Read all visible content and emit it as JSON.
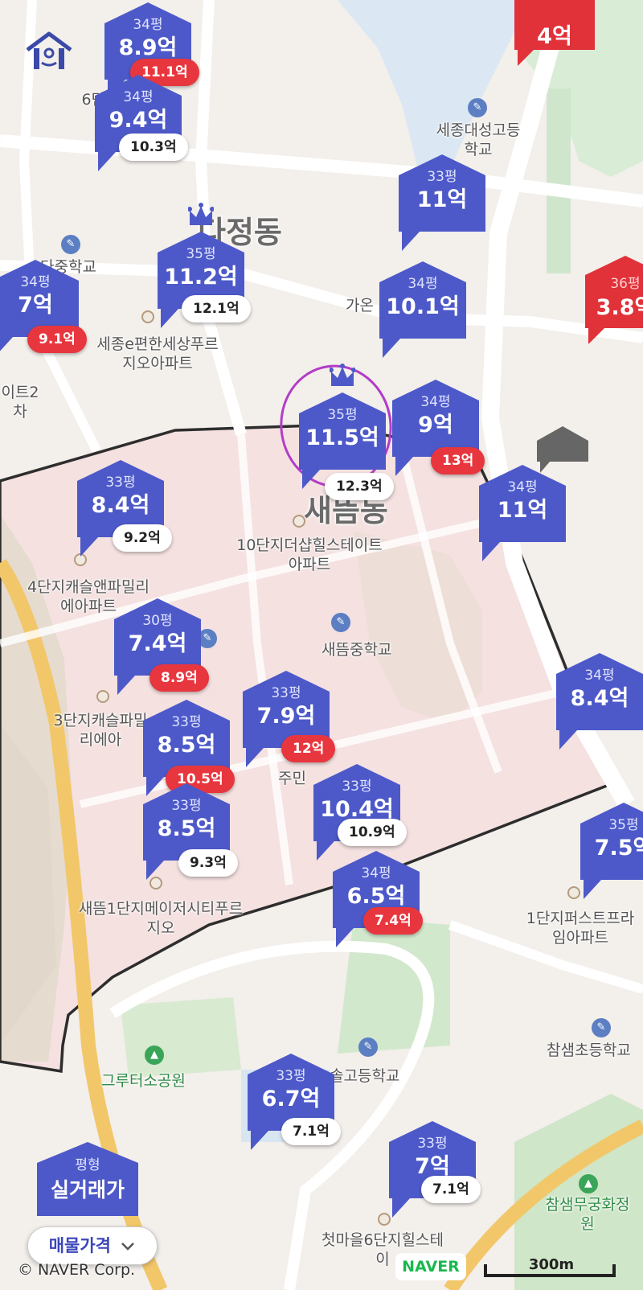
{
  "colors": {
    "marker_blue": "#4d59c8",
    "marker_red": "#e13139",
    "pill_red": "#e8363e",
    "crown": "#4d59c8",
    "highlight_circle": "#b23cc7"
  },
  "dong_labels": {
    "top": "다정동",
    "center": "새뜸동"
  },
  "place_labels": [
    "6단지캐스센트",
    "세종대성고등학교",
    "다중학교",
    "세종e편한세상푸르지오아파트",
    "가온",
    "이트2차",
    "10단지더샵힐스테이트아파트",
    "4단지캐슬앤파밀리에아파트",
    "새뜸중학교",
    "3단지캐슬파밀리에아",
    "주민",
    "새뜸1단지메이저시티푸르지오",
    "1단지퍼스트프라임아파트",
    "참샘초등학교",
    "그루터소공원",
    "솔고등학교",
    "참샘무궁화정원",
    "첫마을6단지힐스테이"
  ],
  "poi_icons": [
    "school-icon",
    "park-icon",
    "apartment-icon"
  ],
  "markers": [
    {
      "area": "34평",
      "price": "8.9억",
      "pill": "11.1억",
      "pill_color": "red"
    },
    {
      "area": "34평",
      "price": "9.4억",
      "pill": "10.3억",
      "pill_color": "white"
    },
    {
      "area": "33평",
      "price": "11억",
      "pill": "",
      "pill_color": ""
    },
    {
      "area": "35평",
      "price": "11.2억",
      "pill": "12.1억",
      "pill_color": "white",
      "crown": true
    },
    {
      "area": "34평",
      "price": "7억",
      "pill": "9.1억",
      "pill_color": "red"
    },
    {
      "area": "34평",
      "price": "10.1억",
      "pill": "",
      "pill_color": ""
    },
    {
      "area": "35평",
      "price": "11.5억",
      "pill": "12.3억",
      "pill_color": "white",
      "crown": true,
      "highlighted": true
    },
    {
      "area": "34평",
      "price": "9억",
      "pill": "13억",
      "pill_color": "red"
    },
    {
      "area": "34평",
      "price": "11억",
      "pill": "",
      "pill_color": ""
    },
    {
      "area": "33평",
      "price": "8.4억",
      "pill": "9.2억",
      "pill_color": "white"
    },
    {
      "area": "30평",
      "price": "7.4억",
      "pill": "8.9억",
      "pill_color": "red"
    },
    {
      "area": "33평",
      "price": "7.9억",
      "pill": "12억",
      "pill_color": "red"
    },
    {
      "area": "33평",
      "price": "8.5억",
      "pill": "10.5억",
      "pill_color": "red"
    },
    {
      "area": "34평",
      "price": "8.4억",
      "pill": "",
      "pill_color": ""
    },
    {
      "area": "33평",
      "price": "10.4억",
      "pill": "10.9억",
      "pill_color": "white"
    },
    {
      "area": "33평",
      "price": "8.5억",
      "pill": "9.3억",
      "pill_color": "white"
    },
    {
      "area": "34평",
      "price": "6.5억",
      "pill": "7.4억",
      "pill_color": "red"
    },
    {
      "area": "35평",
      "price": "7.5억",
      "pill": "",
      "pill_color": ""
    },
    {
      "area": "33평",
      "price": "6.7억",
      "pill": "7.1억",
      "pill_color": "white"
    },
    {
      "area": "33평",
      "price": "7억",
      "pill": "7.1억",
      "pill_color": "white"
    }
  ],
  "red_markers": [
    {
      "area": "",
      "price": "4억"
    },
    {
      "area": "36평",
      "price": "3.8억"
    }
  ],
  "legend": {
    "area": "평형",
    "price": "실거래가"
  },
  "price_toggle": {
    "label": "매물가격",
    "icon": "chevron-down-icon"
  },
  "copyright": "© NAVER Corp.",
  "naver_logo": "NAVER",
  "scale": "300m"
}
